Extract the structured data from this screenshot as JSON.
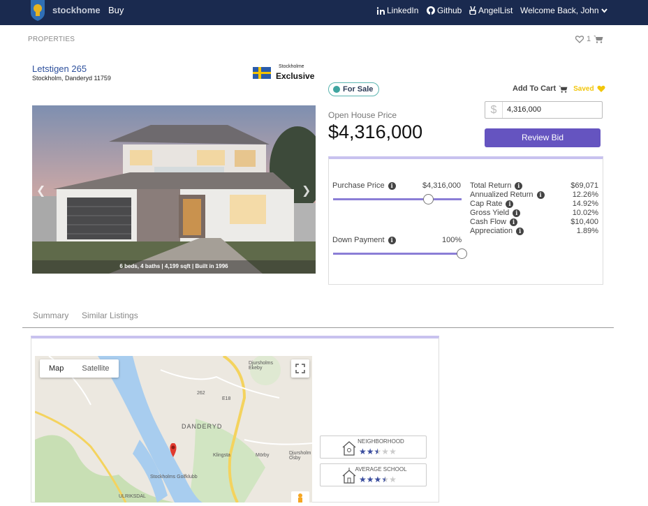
{
  "navbar": {
    "brand": "stockhome",
    "buy": "Buy",
    "linkedin": "LinkedIn",
    "github": "Github",
    "angellist": "AngelList",
    "welcome": "Welcome Back, John"
  },
  "page": {
    "section_label": "PROPERTIES",
    "saved_count": "1"
  },
  "listing": {
    "address": "Letstigen 265",
    "locality": "Stockholm, Danderyd 11759",
    "exclusive_small": "Stockholme",
    "exclusive_big": "Exclusive",
    "photo_caption": "6 beds, 4 baths | 4,199 sqft | Built in 1996",
    "status": "For Sale",
    "add_to_cart": "Add To Cart",
    "saved": "Saved",
    "open_house_label": "Open House Price",
    "open_house_price": "$4,316,000"
  },
  "bid": {
    "currency_symbol": "$",
    "value": "4,316,000",
    "button": "Review Bid"
  },
  "calculator": {
    "purchase_price_label": "Purchase Price",
    "purchase_price_value": "$4,316,000",
    "purchase_slider_fraction": 0.74,
    "down_payment_label": "Down Payment",
    "down_payment_value": "100%",
    "down_payment_slider_fraction": 1.0,
    "metrics": [
      {
        "label": "Total Return",
        "value": "$69,071"
      },
      {
        "label": "Annualized Return",
        "value": "12.26%"
      },
      {
        "label": "Cap Rate",
        "value": "14.92%"
      },
      {
        "label": "Gross Yield",
        "value": "10.02%"
      },
      {
        "label": "Cash Flow",
        "value": "$10,400"
      },
      {
        "label": "Appreciation",
        "value": "1.89%"
      }
    ]
  },
  "tabs": [
    {
      "label": "Summary"
    },
    {
      "label": "Similar Listings"
    }
  ],
  "map": {
    "map_button": "Map",
    "satellite_button": "Satellite",
    "labels": {
      "danderyd": "DANDERYD",
      "djursholms_ekeby": "Djursholms Ekeby",
      "klingsta": "Klingsta",
      "morby": "Mörby",
      "djursholm_osby": "Djursholm Ösby",
      "golfklubb": "Stockholms Golfklubb",
      "ulriksdal": "ULRIKSDAL",
      "road_262": "262",
      "road_e18": "E18"
    }
  },
  "ratings": [
    {
      "title": "NEIGHBORHOOD",
      "stars": 2.5,
      "max": 5
    },
    {
      "title": "AVERAGE SCHOOL",
      "stars": 3.5,
      "max": 5
    }
  ]
}
